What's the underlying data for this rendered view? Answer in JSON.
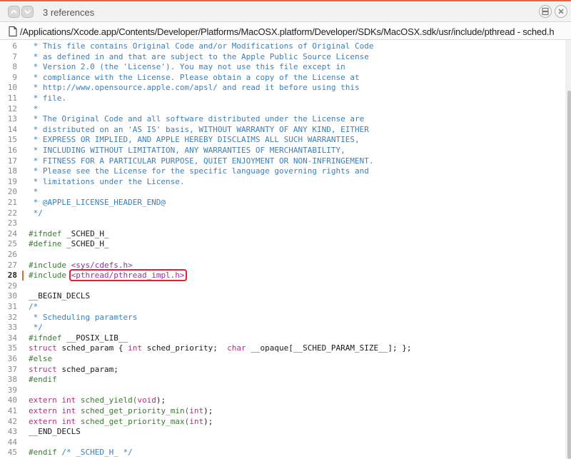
{
  "toolbar": {
    "references_label": "3 references"
  },
  "path": {
    "text": "/Applications/Xcode.app/Contents/Developer/Platforms/MacOSX.platform/Developer/SDKs/MacOSX.sdk/usr/include/pthread - sched.h"
  },
  "editor": {
    "current_line": 28,
    "lines": [
      {
        "n": "6",
        "segs": [
          {
            "t": " * This file contains Original Code and/or Modifications of Original Code",
            "c": "c-comment"
          }
        ]
      },
      {
        "n": "7",
        "segs": [
          {
            "t": " * as defined in and that are subject to the Apple Public Source License",
            "c": "c-comment"
          }
        ]
      },
      {
        "n": "8",
        "segs": [
          {
            "t": " * Version 2.0 (the 'License'). You may not use this file except in",
            "c": "c-comment"
          }
        ]
      },
      {
        "n": "9",
        "segs": [
          {
            "t": " * compliance with the License. Please obtain a copy of the License at",
            "c": "c-comment"
          }
        ]
      },
      {
        "n": "10",
        "segs": [
          {
            "t": " * http://www.opensource.apple.com/apsl/ and read it before using this",
            "c": "c-comment"
          }
        ]
      },
      {
        "n": "11",
        "segs": [
          {
            "t": " * file.",
            "c": "c-comment"
          }
        ]
      },
      {
        "n": "12",
        "segs": [
          {
            "t": " *",
            "c": "c-comment"
          }
        ]
      },
      {
        "n": "13",
        "segs": [
          {
            "t": " * The Original Code and all software distributed under the License are",
            "c": "c-comment"
          }
        ]
      },
      {
        "n": "14",
        "segs": [
          {
            "t": " * distributed on an 'AS IS' basis, WITHOUT WARRANTY OF ANY KIND, EITHER",
            "c": "c-comment"
          }
        ]
      },
      {
        "n": "15",
        "segs": [
          {
            "t": " * EXPRESS OR IMPLIED, AND APPLE HEREBY DISCLAIMS ALL SUCH WARRANTIES,",
            "c": "c-comment"
          }
        ]
      },
      {
        "n": "16",
        "segs": [
          {
            "t": " * INCLUDING WITHOUT LIMITATION, ANY WARRANTIES OF MERCHANTABILITY,",
            "c": "c-comment"
          }
        ]
      },
      {
        "n": "17",
        "segs": [
          {
            "t": " * FITNESS FOR A PARTICULAR PURPOSE, QUIET ENJOYMENT OR NON-INFRINGEMENT.",
            "c": "c-comment"
          }
        ]
      },
      {
        "n": "18",
        "segs": [
          {
            "t": " * Please see the License for the specific language governing rights and",
            "c": "c-comment"
          }
        ]
      },
      {
        "n": "19",
        "segs": [
          {
            "t": " * limitations under the License.",
            "c": "c-comment"
          }
        ]
      },
      {
        "n": "20",
        "segs": [
          {
            "t": " *",
            "c": "c-comment"
          }
        ]
      },
      {
        "n": "21",
        "segs": [
          {
            "t": " * @APPLE_LICENSE_HEADER_END@",
            "c": "c-comment"
          }
        ]
      },
      {
        "n": "22",
        "segs": [
          {
            "t": " */",
            "c": "c-comment"
          }
        ]
      },
      {
        "n": "23",
        "segs": []
      },
      {
        "n": "24",
        "segs": [
          {
            "t": "#ifndef",
            "c": "c-pp"
          },
          {
            "t": " _SCHED_H_",
            "c": ""
          }
        ]
      },
      {
        "n": "25",
        "segs": [
          {
            "t": "#define",
            "c": "c-pp"
          },
          {
            "t": " _SCHED_H_",
            "c": ""
          }
        ]
      },
      {
        "n": "26",
        "segs": []
      },
      {
        "n": "27",
        "segs": [
          {
            "t": "#include ",
            "c": "c-pp"
          },
          {
            "t": "<sys/cdefs.h>",
            "c": "c-str"
          }
        ]
      },
      {
        "n": "28",
        "segs": [
          {
            "t": "#include ",
            "c": "c-pp"
          },
          {
            "t": "<pthread/pthread_impl.h>",
            "c": "c-str highlight-box"
          }
        ]
      },
      {
        "n": "29",
        "segs": []
      },
      {
        "n": "30",
        "segs": [
          {
            "t": "__BEGIN_DECLS",
            "c": ""
          }
        ]
      },
      {
        "n": "31",
        "segs": [
          {
            "t": "/*",
            "c": "c-comment"
          }
        ]
      },
      {
        "n": "32",
        "segs": [
          {
            "t": " * Scheduling paramters",
            "c": "c-comment"
          }
        ]
      },
      {
        "n": "33",
        "segs": [
          {
            "t": " */",
            "c": "c-comment"
          }
        ]
      },
      {
        "n": "34",
        "segs": [
          {
            "t": "#ifndef",
            "c": "c-pp"
          },
          {
            "t": " __POSIX_LIB__",
            "c": ""
          }
        ]
      },
      {
        "n": "35",
        "segs": [
          {
            "t": "struct",
            "c": "c-kw"
          },
          {
            "t": " sched_param { ",
            "c": ""
          },
          {
            "t": "int",
            "c": "c-kw"
          },
          {
            "t": " sched_priority;  ",
            "c": ""
          },
          {
            "t": "char",
            "c": "c-kw"
          },
          {
            "t": " __opaque[__SCHED_PARAM_SIZE__]; };",
            "c": ""
          }
        ]
      },
      {
        "n": "36",
        "segs": [
          {
            "t": "#else",
            "c": "c-pp"
          }
        ]
      },
      {
        "n": "37",
        "segs": [
          {
            "t": "struct",
            "c": "c-kw"
          },
          {
            "t": " sched_param;",
            "c": ""
          }
        ]
      },
      {
        "n": "38",
        "segs": [
          {
            "t": "#endif",
            "c": "c-pp"
          }
        ]
      },
      {
        "n": "39",
        "segs": []
      },
      {
        "n": "40",
        "segs": [
          {
            "t": "extern",
            "c": "c-kw"
          },
          {
            "t": " ",
            "c": ""
          },
          {
            "t": "int",
            "c": "c-kw"
          },
          {
            "t": " sched_yield(",
            "c": "c-pp"
          },
          {
            "t": "void",
            "c": "c-kw"
          },
          {
            "t": ");",
            "c": ""
          }
        ]
      },
      {
        "n": "41",
        "segs": [
          {
            "t": "extern",
            "c": "c-kw"
          },
          {
            "t": " ",
            "c": ""
          },
          {
            "t": "int",
            "c": "c-kw"
          },
          {
            "t": " sched_get_priority_min(",
            "c": "c-pp"
          },
          {
            "t": "int",
            "c": "c-kw"
          },
          {
            "t": ");",
            "c": ""
          }
        ]
      },
      {
        "n": "42",
        "segs": [
          {
            "t": "extern",
            "c": "c-kw"
          },
          {
            "t": " ",
            "c": ""
          },
          {
            "t": "int",
            "c": "c-kw"
          },
          {
            "t": " sched_get_priority_max(",
            "c": "c-pp"
          },
          {
            "t": "int",
            "c": "c-kw"
          },
          {
            "t": ");",
            "c": ""
          }
        ]
      },
      {
        "n": "43",
        "segs": [
          {
            "t": "__END_DECLS",
            "c": ""
          }
        ]
      },
      {
        "n": "44",
        "segs": []
      },
      {
        "n": "45",
        "segs": [
          {
            "t": "#endif",
            "c": "c-pp"
          },
          {
            "t": " /* _SCHED_H_ */",
            "c": "c-comment"
          }
        ]
      }
    ]
  }
}
